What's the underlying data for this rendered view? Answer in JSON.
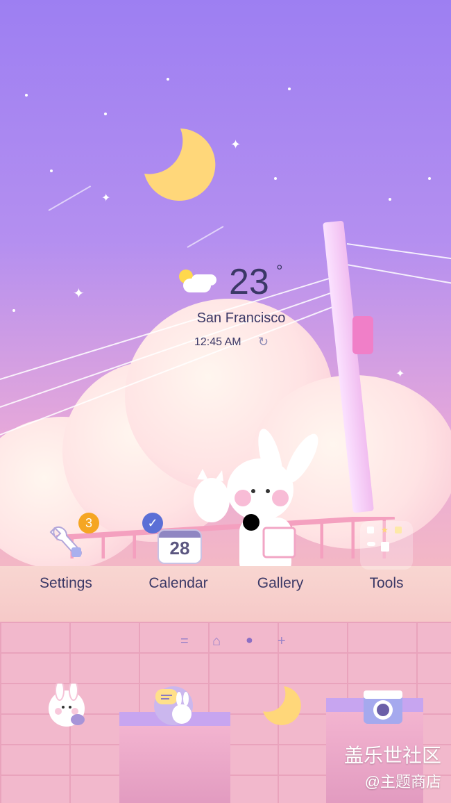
{
  "weather": {
    "temperature": "23",
    "degree_symbol": "°",
    "city": "San Francisco",
    "time": "12:45 AM",
    "condition_icon": "partly-cloudy-icon",
    "refresh_icon": "refresh-icon"
  },
  "apps": [
    {
      "label": "Settings",
      "icon": "wrench-icon",
      "badge": "3"
    },
    {
      "label": "Calendar",
      "icon": "calendar-icon",
      "badge_icon": "check-icon",
      "date": "28"
    },
    {
      "label": "Gallery",
      "icon": "camera-bunny-icon"
    },
    {
      "label": "Tools",
      "icon": "folder-icon"
    }
  ],
  "pager": {
    "items": [
      "=",
      "⌂",
      "●",
      "+"
    ]
  },
  "dock": [
    {
      "icon": "phone-bunny-icon"
    },
    {
      "icon": "messages-bunny-icon"
    },
    {
      "icon": "moon-icon"
    },
    {
      "icon": "camera-icon"
    }
  ],
  "watermark": {
    "line1": "盖乐世社区",
    "line2": "@主题商店"
  },
  "colors": {
    "text": "#3b3866",
    "badge_orange": "#f5a623",
    "badge_blue": "#5b6fd6"
  }
}
